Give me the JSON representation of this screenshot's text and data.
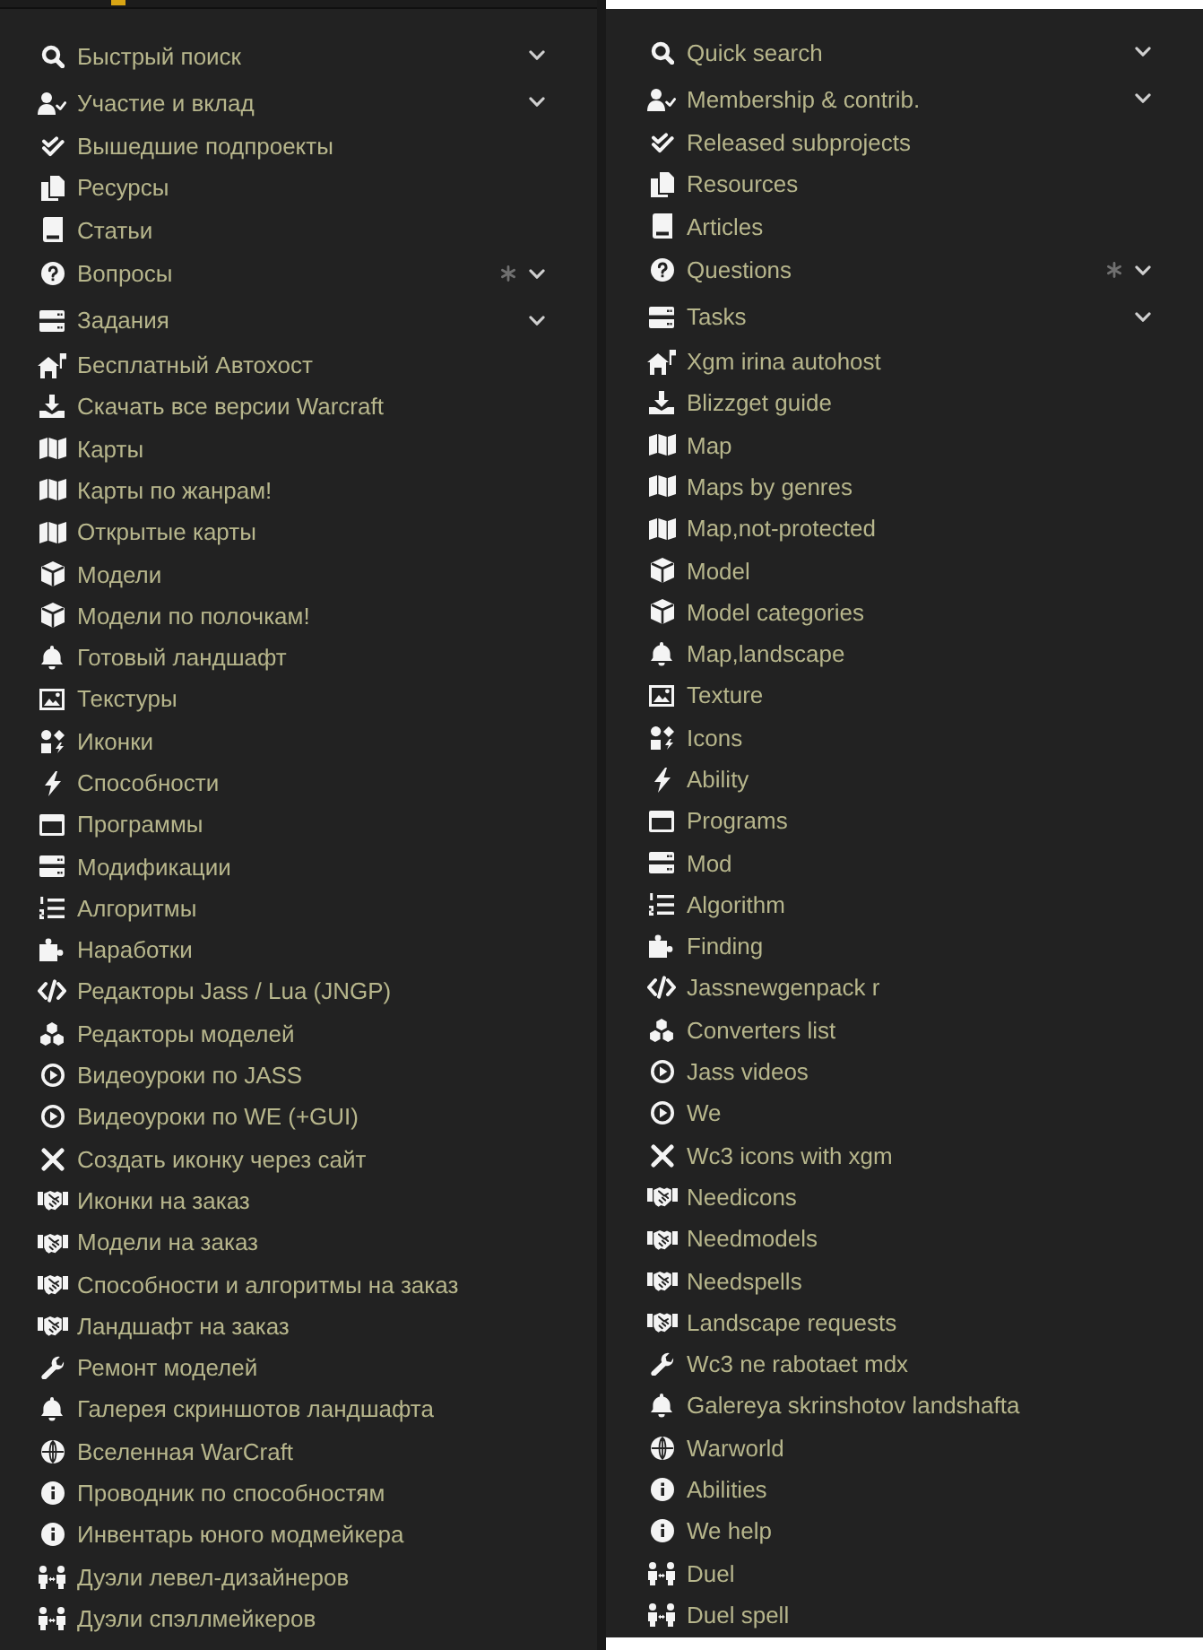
{
  "panels": [
    {
      "items": [
        {
          "kind": "section",
          "label": "Быстрый поиск",
          "marked": false
        },
        {
          "kind": "section",
          "label": "Участие и вклад",
          "marked": false
        },
        {
          "kind": "link",
          "label": "Вышедшие подпроекты",
          "marked": false
        },
        {
          "kind": "link",
          "label": "Ресурсы",
          "marked": false
        },
        {
          "kind": "link",
          "label": "Статьи",
          "marked": false
        },
        {
          "kind": "section",
          "label": "Вопросы",
          "marked": true
        },
        {
          "kind": "section",
          "label": "Задания",
          "marked": false
        },
        {
          "kind": "link",
          "label": "Бесплатный Автохост",
          "marked": false
        },
        {
          "kind": "link",
          "label": "Скачать все версии Warcraft",
          "marked": false
        },
        {
          "kind": "link",
          "label": "Карты",
          "marked": false
        },
        {
          "kind": "link",
          "label": "Карты по жанрам!",
          "marked": false
        },
        {
          "kind": "link",
          "label": "Открытые карты",
          "marked": false
        },
        {
          "kind": "link",
          "label": "Модели",
          "marked": false
        },
        {
          "kind": "link",
          "label": "Модели по полочкам!",
          "marked": false
        },
        {
          "kind": "link",
          "label": "Готовый ландшафт",
          "marked": false
        },
        {
          "kind": "link",
          "label": "Текстуры",
          "marked": false
        },
        {
          "kind": "link",
          "label": "Иконки",
          "marked": false
        },
        {
          "kind": "link",
          "label": "Способности",
          "marked": false
        },
        {
          "kind": "link",
          "label": "Программы",
          "marked": false
        },
        {
          "kind": "link",
          "label": "Модификации",
          "marked": false
        },
        {
          "kind": "link",
          "label": "Алгоритмы",
          "marked": false
        },
        {
          "kind": "link",
          "label": "Наработки",
          "marked": false
        },
        {
          "kind": "link",
          "label": "Редакторы Jass / Lua (JNGP)",
          "marked": false
        },
        {
          "kind": "link",
          "label": "Редакторы моделей",
          "marked": false
        },
        {
          "kind": "link",
          "label": "Видеоуроки по JASS",
          "marked": false
        },
        {
          "kind": "link",
          "label": "Видеоуроки по WE (+GUI)",
          "marked": false
        },
        {
          "kind": "link",
          "label": "Создать иконку через сайт",
          "marked": false
        },
        {
          "kind": "link",
          "label": "Иконки на заказ",
          "marked": false
        },
        {
          "kind": "link",
          "label": "Модели на заказ",
          "marked": false
        },
        {
          "kind": "link",
          "label": "Способности и алгоритмы на заказ",
          "marked": false
        },
        {
          "kind": "link",
          "label": "Ландшафт на заказ",
          "marked": false
        },
        {
          "kind": "link",
          "label": "Ремонт моделей",
          "marked": false
        },
        {
          "kind": "link",
          "label": "Галерея скриншотов ландшафта",
          "marked": false
        },
        {
          "kind": "link",
          "label": "Вселенная WarCraft",
          "marked": false
        },
        {
          "kind": "link",
          "label": "Проводник по способностям",
          "marked": false
        },
        {
          "kind": "link",
          "label": "Инвентарь юного модмейкера",
          "marked": false
        },
        {
          "kind": "link",
          "label": "Дуэли левел-дизайнеров",
          "marked": false
        },
        {
          "kind": "link",
          "label": "Дуэли спэллмейкеров",
          "marked": false
        }
      ]
    },
    {
      "items": [
        {
          "kind": "section",
          "label": "Quick search",
          "marked": false
        },
        {
          "kind": "section",
          "label": "Membership & contrib.",
          "marked": false
        },
        {
          "kind": "link",
          "label": "Released subprojects",
          "marked": false
        },
        {
          "kind": "link",
          "label": "Resources",
          "marked": false
        },
        {
          "kind": "link",
          "label": "Articles",
          "marked": false
        },
        {
          "kind": "section",
          "label": "Questions",
          "marked": true
        },
        {
          "kind": "section",
          "label": "Tasks",
          "marked": false
        },
        {
          "kind": "link",
          "label": "Xgm irina autohost",
          "marked": false
        },
        {
          "kind": "link",
          "label": "Blizzget guide",
          "marked": false
        },
        {
          "kind": "link",
          "label": "Map",
          "marked": false
        },
        {
          "kind": "link",
          "label": "Maps by genres",
          "marked": false
        },
        {
          "kind": "link",
          "label": "Map,not-protected",
          "marked": false
        },
        {
          "kind": "link",
          "label": "Model",
          "marked": false
        },
        {
          "kind": "link",
          "label": "Model categories",
          "marked": false
        },
        {
          "kind": "link",
          "label": "Map,landscape",
          "marked": false
        },
        {
          "kind": "link",
          "label": "Texture",
          "marked": false
        },
        {
          "kind": "link",
          "label": "Icons",
          "marked": false
        },
        {
          "kind": "link",
          "label": "Ability",
          "marked": false
        },
        {
          "kind": "link",
          "label": "Programs",
          "marked": false
        },
        {
          "kind": "link",
          "label": "Mod",
          "marked": false
        },
        {
          "kind": "link",
          "label": "Algorithm",
          "marked": false
        },
        {
          "kind": "link",
          "label": "Finding",
          "marked": false
        },
        {
          "kind": "link",
          "label": "Jassnewgenpack r",
          "marked": false
        },
        {
          "kind": "link",
          "label": "Converters list",
          "marked": false
        },
        {
          "kind": "link",
          "label": "Jass videos",
          "marked": false
        },
        {
          "kind": "link",
          "label": "We",
          "marked": false
        },
        {
          "kind": "link",
          "label": "Wc3 icons with xgm",
          "marked": false
        },
        {
          "kind": "link",
          "label": "Needicons",
          "marked": false
        },
        {
          "kind": "link",
          "label": "Needmodels",
          "marked": false
        },
        {
          "kind": "link",
          "label": "Needspells",
          "marked": false
        },
        {
          "kind": "link",
          "label": "Landscape requests",
          "marked": false
        },
        {
          "kind": "link",
          "label": "Wc3 ne rabotaet mdx",
          "marked": false
        },
        {
          "kind": "link",
          "label": "Galereya skrinshotov landshafta",
          "marked": false
        },
        {
          "kind": "link",
          "label": "Warworld",
          "marked": false
        },
        {
          "kind": "link",
          "label": "Abilities",
          "marked": false
        },
        {
          "kind": "link",
          "label": "We help",
          "marked": false
        },
        {
          "kind": "link",
          "label": "Duel",
          "marked": false
        },
        {
          "kind": "link",
          "label": "Duel spell",
          "marked": false
        }
      ]
    }
  ]
}
